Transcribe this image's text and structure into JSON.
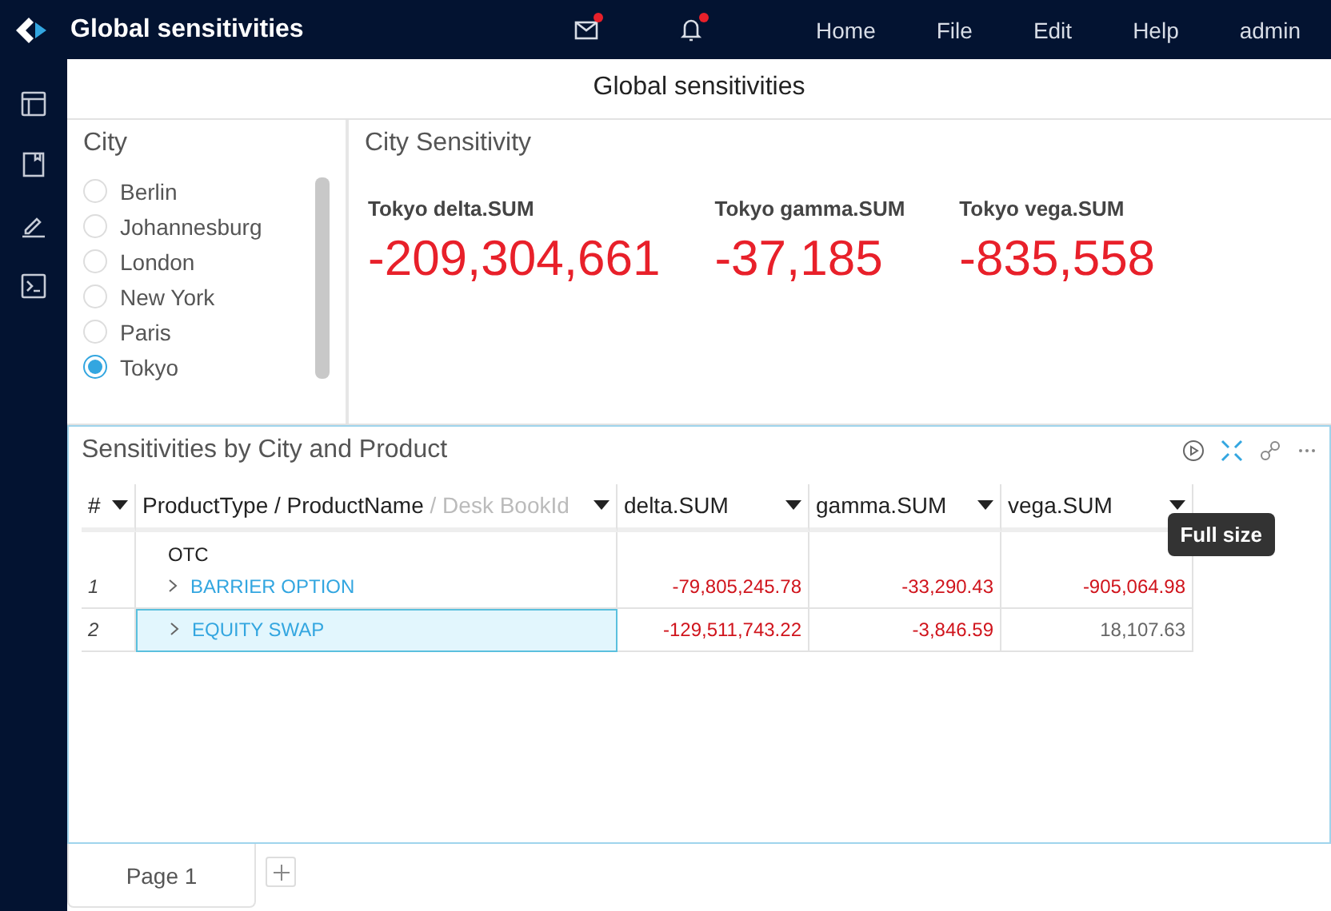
{
  "app_bar": {
    "title": "Global sensitivities",
    "notifications": [
      {
        "kind": "mail",
        "unread": true
      },
      {
        "kind": "bell",
        "unread": true
      }
    ],
    "menu": [
      "Home",
      "File",
      "Edit",
      "Help",
      "admin"
    ]
  },
  "sidebar": {
    "icons": [
      {
        "kind": "layout"
      },
      {
        "kind": "bookmark"
      },
      {
        "kind": "pen"
      },
      {
        "kind": "terminal"
      }
    ]
  },
  "page_title": "Global sensitivities",
  "city_filter": {
    "title": "City",
    "options": [
      {
        "label": "Berlin",
        "selected": false
      },
      {
        "label": "Johannesburg",
        "selected": false
      },
      {
        "label": "London",
        "selected": false
      },
      {
        "label": "New York",
        "selected": false
      },
      {
        "label": "Paris",
        "selected": false
      },
      {
        "label": "Tokyo",
        "selected": true
      }
    ]
  },
  "city_sensitivity": {
    "title": "City Sensitivity",
    "kpis": [
      {
        "label": "Tokyo delta.SUM",
        "value": "-209,304,661",
        "negative": true
      },
      {
        "label": "Tokyo gamma.SUM",
        "value": "-37,185",
        "negative": true
      },
      {
        "label": "Tokyo vega.SUM",
        "value": "-835,558",
        "negative": true
      }
    ]
  },
  "table_panel": {
    "title": "Sensitivities by City and Product",
    "tooltip": "Full size",
    "columns": [
      {
        "label": "#"
      },
      {
        "label": "ProductType / ProductName",
        "extra": "/ Desk BookId"
      },
      {
        "label": "delta.SUM"
      },
      {
        "label": "gamma.SUM"
      },
      {
        "label": "vega.SUM"
      }
    ],
    "rows": [
      {
        "group": "OTC",
        "index": "1",
        "name": "BARRIER OPTION",
        "selected": false,
        "values": [
          {
            "text": "-79,805,245.78",
            "negative": true
          },
          {
            "text": "-33,290.43",
            "negative": true
          },
          {
            "text": "-905,064.98",
            "negative": true
          }
        ]
      },
      {
        "index": "2",
        "name": "EQUITY SWAP",
        "selected": true,
        "values": [
          {
            "text": "-129,511,743.22",
            "negative": true
          },
          {
            "text": "-3,846.59",
            "negative": true
          },
          {
            "text": "18,107.63",
            "negative": false
          }
        ]
      }
    ]
  },
  "page_tabs": [
    {
      "label": "Page 1",
      "selected": true
    }
  ]
}
